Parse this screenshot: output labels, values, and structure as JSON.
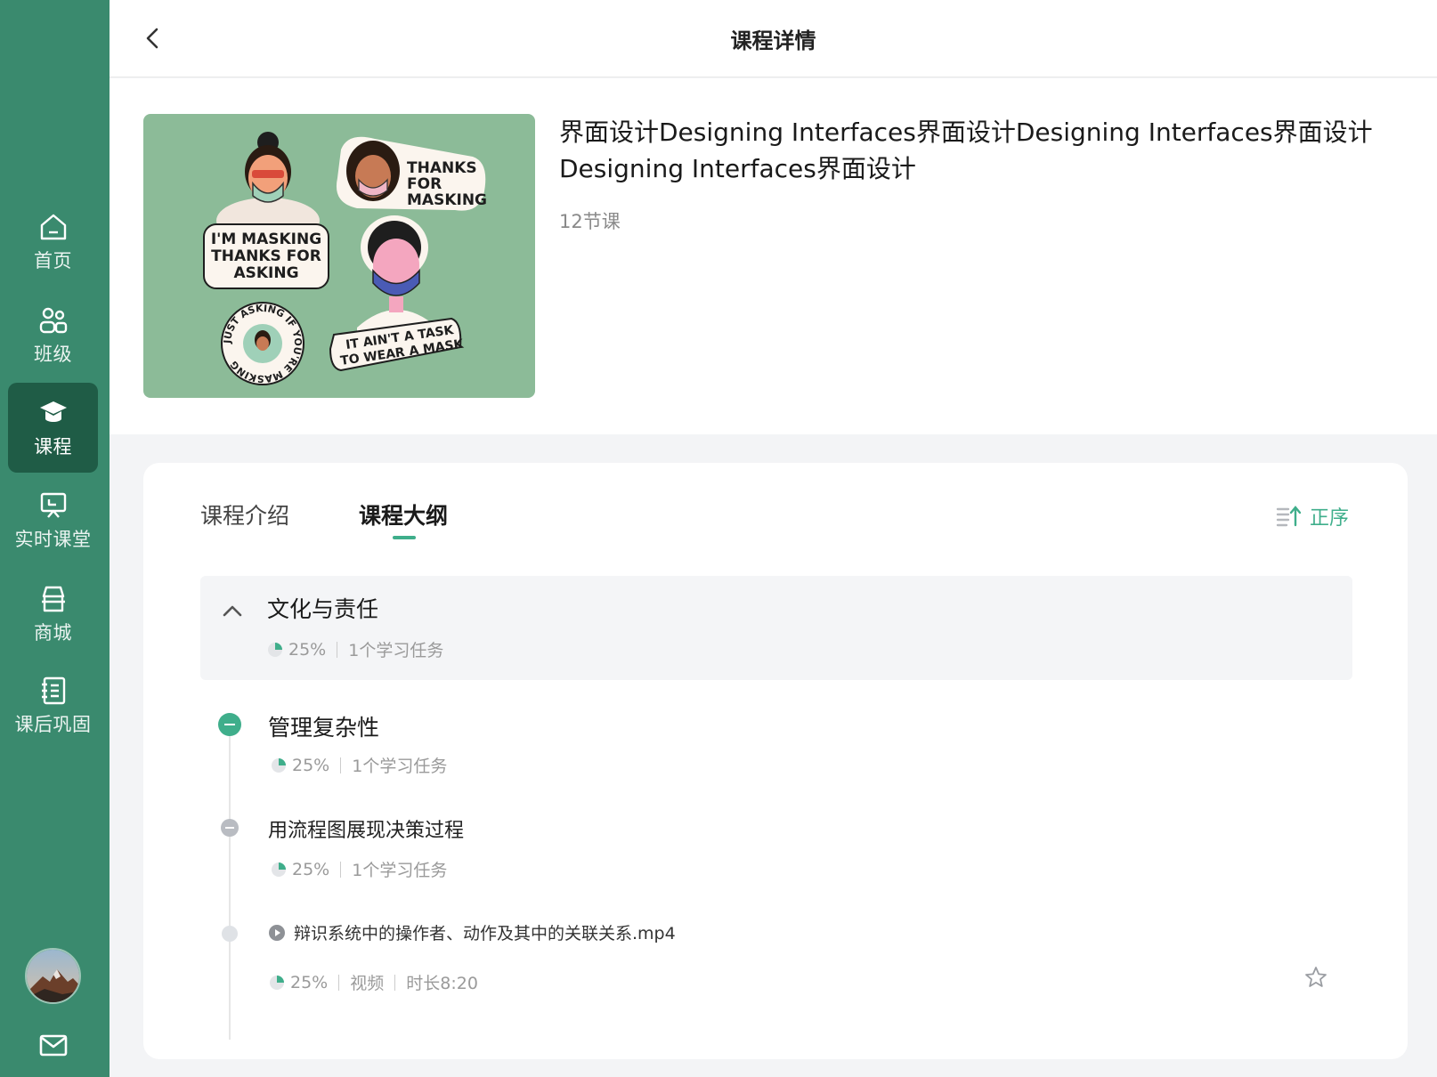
{
  "header": {
    "title": "课程详情"
  },
  "sidebar": {
    "items": [
      {
        "label": "首页",
        "icon": "home-icon"
      },
      {
        "label": "班级",
        "icon": "class-icon"
      },
      {
        "label": "课程",
        "icon": "graduation-cap-icon"
      },
      {
        "label": "实时课堂",
        "icon": "live-classroom-icon"
      },
      {
        "label": "商城",
        "icon": "store-icon"
      },
      {
        "label": "课后巩固",
        "icon": "notebook-icon"
      }
    ],
    "active": "课程"
  },
  "course": {
    "title": "界面设计Designing Interfaces界面设计Designing Interfaces界面设计Designing Interfaces界面设计",
    "lesson_count": "12节课",
    "cover_texts": {
      "sticker1": [
        "I'M MASKING",
        "THANKS FOR",
        "ASKING"
      ],
      "sticker2": [
        "THANKS",
        "FOR",
        "MASKING"
      ],
      "sticker3": [
        "IT AIN'T A TASK",
        "TO WEAR A MASK"
      ],
      "sticker4": "JUST ASKING IF YOU'RE MASKING"
    }
  },
  "tabs": {
    "intro": "课程介绍",
    "outline": "课程大纲",
    "active": "outline"
  },
  "sort": {
    "label": "正序"
  },
  "outline": {
    "chapter": {
      "title": "文化与责任",
      "progress": "25%",
      "tasks": "1个学习任务"
    },
    "section": {
      "title": "管理复杂性",
      "progress": "25%",
      "tasks": "1个学习任务"
    },
    "subsection": {
      "title": "用流程图展现决策过程",
      "progress": "25%",
      "tasks": "1个学习任务"
    },
    "item": {
      "title": "辩识系统中的操作者、动作及其中的关联关系.mp4",
      "progress": "25%",
      "type": "视频",
      "duration": "时长8:20"
    }
  },
  "colors": {
    "sidebar": "#3a8a6e",
    "sidebar_active": "#1f5c46",
    "accent": "#3fae8b",
    "cover_bg": "#8cbb98"
  }
}
